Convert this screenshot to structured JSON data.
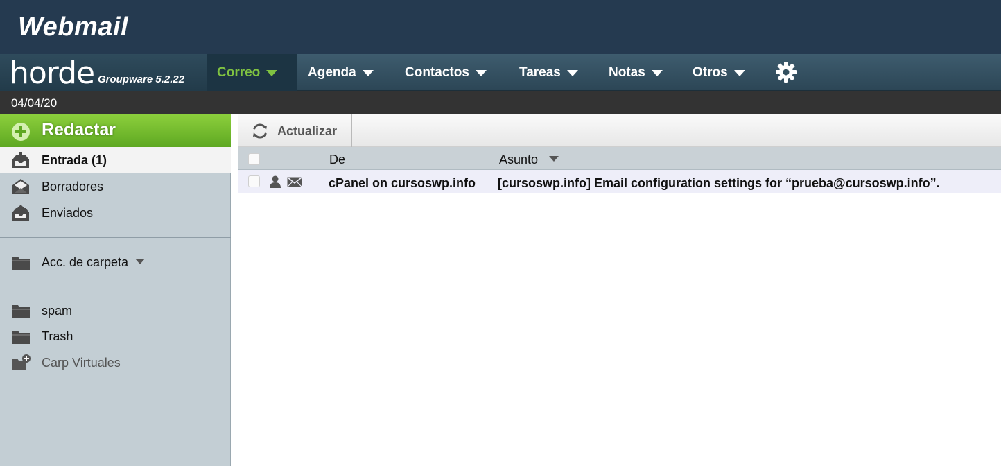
{
  "banner": {
    "title": "Webmail"
  },
  "brand": {
    "logo": "horde",
    "version": "Groupware 5.2.22"
  },
  "nav": {
    "items": [
      {
        "label": "Correo",
        "active": true
      },
      {
        "label": "Agenda"
      },
      {
        "label": "Contactos"
      },
      {
        "label": "Tareas"
      },
      {
        "label": "Notas"
      },
      {
        "label": "Otros"
      }
    ],
    "settings_icon": "gear-icon"
  },
  "date": "04/04/20",
  "sidebar": {
    "compose_label": "Redactar",
    "mailboxes": [
      {
        "label": "Entrada (1)",
        "icon": "inbox-icon",
        "selected": true
      },
      {
        "label": "Borradores",
        "icon": "drafts-icon"
      },
      {
        "label": "Enviados",
        "icon": "sent-icon"
      }
    ],
    "folder_actions_label": "Acc. de carpeta",
    "folders": [
      {
        "label": "spam",
        "icon": "folder-icon"
      },
      {
        "label": "Trash",
        "icon": "folder-icon"
      },
      {
        "label": "Carp Virtuales",
        "icon": "folder-add-icon"
      }
    ]
  },
  "toolbar": {
    "refresh_label": "Actualizar"
  },
  "table": {
    "headers": {
      "from": "De",
      "subject": "Asunto"
    },
    "rows": [
      {
        "from": "cPanel on cursoswp.info",
        "subject": "[cursoswp.info] Email configuration settings for “prueba@cursoswp.info”."
      }
    ]
  },
  "colors": {
    "banner": "#253a50",
    "nav_active_text": "#7fc241",
    "compose_green": "#6bb52b",
    "sidebar_bg": "#c3ced4",
    "row_unread_bg": "#eeeef9"
  }
}
